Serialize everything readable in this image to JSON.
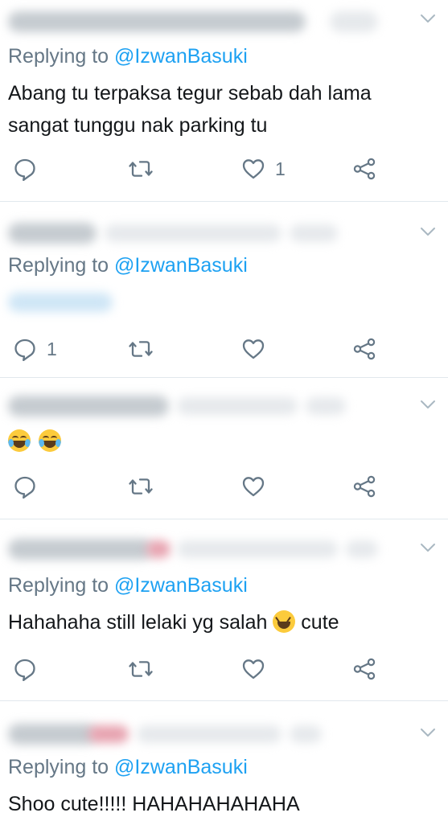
{
  "reply_prefix": "Replying to ",
  "tweets": [
    {
      "handle": "@IzwanBasuki",
      "text": "Abang tu terpaksa tegur sebab dah lama\nsangat tunggu nak parking tu",
      "reply_count": "",
      "like_count": "1"
    },
    {
      "handle": "@IzwanBasuki",
      "text": "",
      "reply_count": "1",
      "like_count": ""
    },
    {
      "handle": "",
      "text": "",
      "reply_count": "",
      "like_count": ""
    },
    {
      "handle": "@IzwanBasuki",
      "text_before": "Hahahaha still lelaki yg salah ",
      "text_after": " cute",
      "reply_count": "",
      "like_count": ""
    },
    {
      "handle": "@IzwanBasuki",
      "text": "Shoo cute!!!!! HAHAHAHAHAHA",
      "reply_count": "",
      "like_count": ""
    }
  ],
  "icons": {
    "reply": "reply-icon",
    "retweet": "retweet-icon",
    "like": "heart-icon",
    "share": "share-icon",
    "menu": "chevron-down-icon",
    "laugh_emoji": "face-with-tears-of-joy-emoji",
    "grin_emoji": "grinning-squinting-face-emoji"
  },
  "colors": {
    "icon_gray": "#657786",
    "link_blue": "#1da1f2",
    "divider": "#e1e8ed"
  }
}
